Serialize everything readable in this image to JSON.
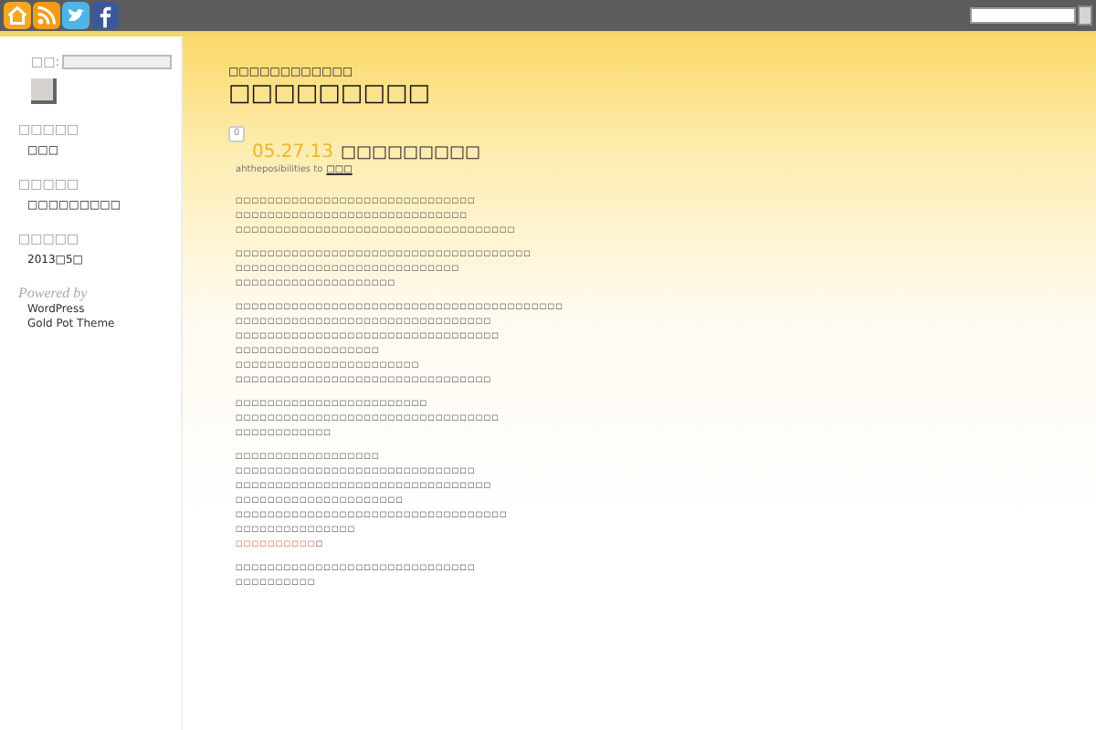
{
  "toolbar": {
    "icons": [
      {
        "kind": "home"
      },
      {
        "kind": "rss"
      },
      {
        "kind": "twitter"
      },
      {
        "kind": "facebook"
      }
    ]
  },
  "sidebar": {
    "search": {
      "label": "□□:"
    },
    "sections": [
      {
        "heading": "□□□□□",
        "items": [
          "□□□"
        ]
      },
      {
        "heading": "□□□□□",
        "items": [
          "□□□□□□□□□"
        ]
      },
      {
        "heading": "□□□□□",
        "items": [
          "2013□5□"
        ]
      }
    ],
    "powered_by": {
      "heading": "Powered by",
      "items": [
        "WordPress",
        "Gold Pot Theme"
      ]
    }
  },
  "blog": {
    "tagline": "□□□□□□□□□□□□",
    "title": "□□□□□□□□□"
  },
  "post": {
    "comments": "0",
    "date": "05.27.13",
    "title": "□□□□□□□□□",
    "author_prefix": "ahtheposibilities to",
    "author_link": "□□□",
    "paragraphs": [
      {
        "lines": [
          "□□□□□□□□□□□□□□□□□□□□□□□□□□□□□□",
          "□□□□□□□□□□□□□□□□□□□□□□□□□□□□□",
          "□□□□□□□□□□□□□□□□□□□□□□□□□□□□□□□□□□□"
        ]
      },
      {
        "lines": [
          "□□□□□□□□□□□□□□□□□□□□□□□□□□□□□□□□□□□□□",
          "□□□□□□□□□□□□□□□□□□□□□□□□□□□□",
          "□□□□□□□□□□□□□□□□□□□□"
        ]
      },
      {
        "lines": [
          "□□□□□□□□□□□□□□□□□□□□□□□□□□□□□□□□□□□□□□□□□",
          "□□□□□□□□□□□□□□□□□□□□□□□□□□□□□□□□",
          "□□□□□□□□□□□□□□□□□□□□□□□□□□□□□□□□□",
          "□□□□□□□□□□□□□□□□□□",
          "□□□□□□□□□□□□□□□□□□□□□□□",
          "□□□□□□□□□□□□□□□□□□□□□□□□□□□□□□□□"
        ]
      },
      {
        "lines": [
          "□□□□□□□□□□□□□□□□□□□□□□□□",
          "□□□□□□□□□□□□□□□□□□□□□□□□□□□□□□□□□",
          "□□□□□□□□□□□□"
        ]
      },
      {
        "lines": [
          "□□□□□□□□□□□□□□□□□□",
          "□□□□□□□□□□□□□□□□□□□□□□□□□□□□□□",
          "□□□□□□□□□□□□□□□□□□□□□□□□□□□□□□□□",
          "□□□□□□□□□□□□□□□□□□□□□",
          "□□□□□□□□□□□□□□□□□□□□□□□□□□□□□□□□□□",
          "□□□□□□□□□□□□□□□"
        ],
        "link": "□□□□□□□□□□",
        "link_suffix": "□"
      },
      {
        "lines": [
          "□□□□□□□□□□□□□□□□□□□□□□□□□□□□□□",
          "□□□□□□□□□□"
        ]
      }
    ]
  }
}
